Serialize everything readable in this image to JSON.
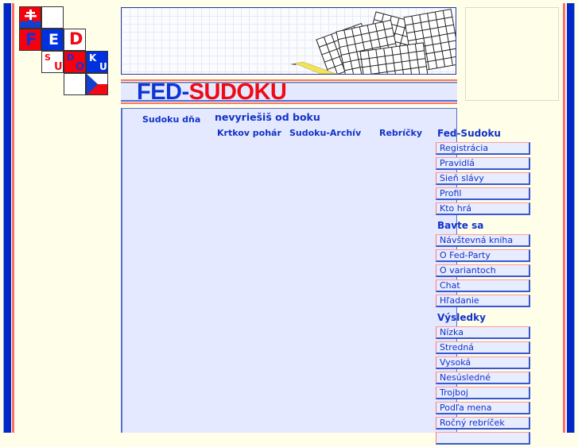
{
  "logo": {
    "letters": {
      "f": "F",
      "e": "E",
      "d": "D",
      "s": "S",
      "u1": "U",
      "d2": "D",
      "o": "O",
      "k": "K",
      "u2": "U"
    },
    "colors": {
      "red": "#f5000c",
      "blue": "#0031e0",
      "white": "#ffffff"
    }
  },
  "header": {
    "title_part1": "FED-",
    "title_part2": "SUDO",
    "title_part3": "KU",
    "title_colors": {
      "blue": "#0d36d6",
      "red": "#f00a14"
    }
  },
  "nav": {
    "sudoku_dna": "Sudoku dňa",
    "tagline": "nevyriešiš od boku",
    "krtkov_pohar": "Krtkov pohár",
    "sudoku_archiv": "Sudoku-Archív",
    "rebricky": "Rebríčky"
  },
  "menu": {
    "sections": [
      {
        "title": "Fed-Sudoku",
        "items": [
          "Registrácia",
          "Pravidlá",
          "Sieň slávy",
          "Profil",
          "Kto hrá"
        ]
      },
      {
        "title": "Bavte sa",
        "items": [
          "Návštevná kniha",
          "O Fed-Party",
          "O variantoch",
          "Chat",
          "Hľadanie"
        ]
      },
      {
        "title": "Výsledky",
        "items": [
          "Nízka",
          "Stredná",
          "Vysoká",
          "Nesúsledné",
          "Trojboj",
          "Podľa mena",
          "Ročný rebríček"
        ]
      }
    ]
  },
  "theme": {
    "accent_blue": "#0029c7",
    "accent_red": "#ff6f6a",
    "panel_bg": "#e4e9ff",
    "page_bg": "#fffee9"
  }
}
